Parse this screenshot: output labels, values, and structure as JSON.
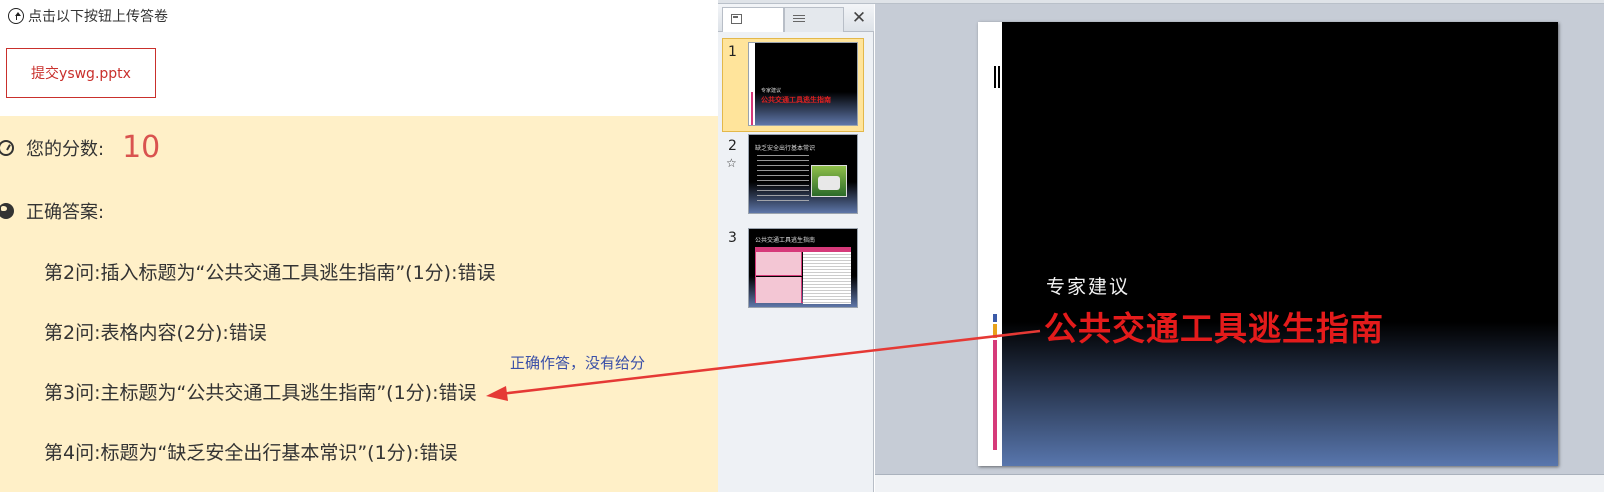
{
  "upload": {
    "hint": "点击以下按钮上传答卷",
    "submit_label": "提交yswg.pptx"
  },
  "score": {
    "label": "您的分数:",
    "value": "10"
  },
  "answers": {
    "label": "正确答案:",
    "items": [
      "第2问:插入标题为“公共交通工具逃生指南”(1分):错误",
      "第2问:表格内容(2分):错误",
      "第3问:主标题为“公共交通工具逃生指南”(1分):错误",
      "第4问:标题为“缺乏安全出行基本常识”(1分):错误"
    ]
  },
  "annotation": "正确作答，没有给分",
  "ppt": {
    "slide_numbers": [
      "1",
      "2",
      "3"
    ],
    "slide": {
      "subtitle": "专家建议",
      "title": "公共交通工具逃生指南"
    },
    "thumb1": {
      "subtitle": "专家建议",
      "title": "公共交通工具逃生指南"
    },
    "thumb2": {
      "title": "缺乏安全出行基本常识"
    },
    "thumb3": {
      "title": "公共交通工具逃生指南"
    }
  },
  "colors": {
    "accent_red": "#d9534f",
    "panel_bg": "#fff0c8",
    "annotation_blue": "#3a4fa8",
    "arrow_red": "#e53935"
  }
}
